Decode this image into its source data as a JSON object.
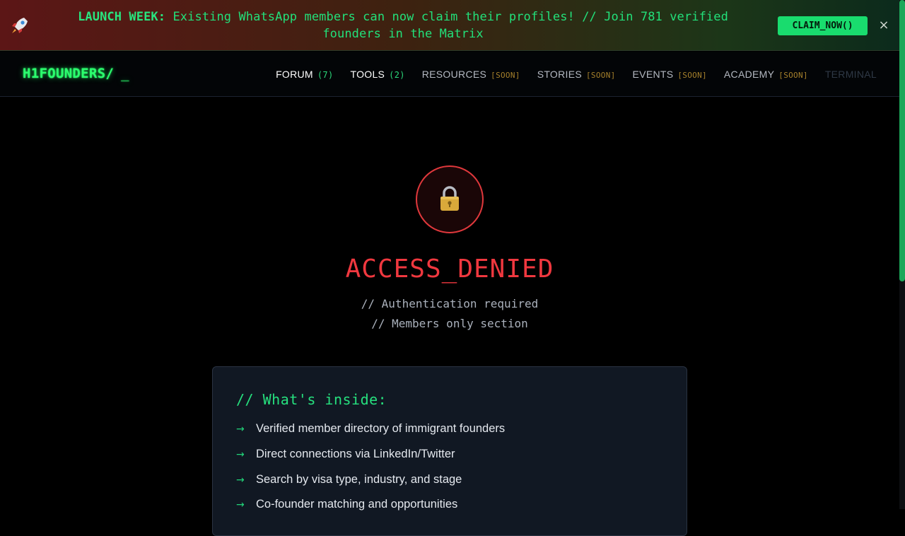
{
  "banner": {
    "icon": "rocket-icon",
    "lead": "LAUNCH WEEK:",
    "message": "Existing WhatsApp members can now claim their profiles! // Join 781 verified founders in the Matrix",
    "cta_label": "CLAIM_NOW()",
    "close_label": "×"
  },
  "nav": {
    "logo": "H1FOUNDERS/",
    "cursor": "_",
    "items": [
      {
        "label": "FORUM",
        "count": "(7)"
      },
      {
        "label": "TOOLS",
        "count": "(2)"
      },
      {
        "label": "RESOURCES",
        "tag": "[SOON]"
      },
      {
        "label": "STORIES",
        "tag": "[SOON]"
      },
      {
        "label": "EVENTS",
        "tag": "[SOON]"
      },
      {
        "label": "ACADEMY",
        "tag": "[SOON]"
      },
      {
        "label": "TERMINAL"
      }
    ]
  },
  "gate": {
    "icon": "lock-icon",
    "title": "ACCESS_DENIED",
    "line1": "// Authentication required",
    "line2": "// Members only section"
  },
  "card": {
    "title": "// What's inside:",
    "arrow": "→",
    "features": [
      "Verified member directory of immigrant founders",
      "Direct connections via LinkedIn/Twitter",
      "Search by visa type, industry, and stage",
      "Co-founder matching and opportunities"
    ]
  },
  "colors": {
    "accent_green": "#22e07a",
    "denied_red": "#f0383f",
    "soon_gold": "#a5802b"
  }
}
